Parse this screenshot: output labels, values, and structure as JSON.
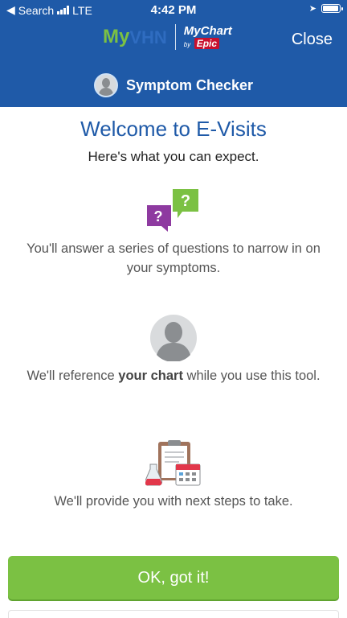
{
  "status_bar": {
    "carrier_label": "Search",
    "network": "LTE",
    "time": "4:42 PM"
  },
  "header": {
    "logo_my": "My",
    "logo_vhn": "VHN",
    "logo_mychart": "MyChart",
    "logo_by": "by",
    "logo_epic": "Epic",
    "close_label": "Close",
    "title": "Symptom Checker"
  },
  "main": {
    "title": "Welcome to E-Visits",
    "subtitle": "Here's what you can expect.",
    "features": [
      {
        "icon": "question-bubbles-icon",
        "text": "You'll answer a series of questions to narrow in on your symptoms."
      },
      {
        "icon": "person-avatar-icon",
        "text_before": "We'll reference ",
        "text_bold": "your chart",
        "text_after": " while you use this tool."
      },
      {
        "icon": "clipboard-calendar-icon",
        "text": "We'll provide you with next steps to take."
      }
    ],
    "ok_button_label": "OK, got it!"
  },
  "colors": {
    "header_blue": "#1f5aa8",
    "accent_green": "#7bc143",
    "title_blue": "#1f5aa8"
  }
}
